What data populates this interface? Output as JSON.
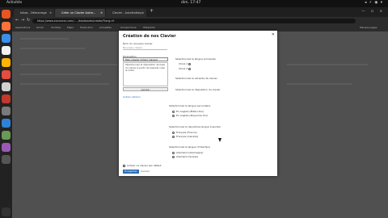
{
  "system": {
    "activities": "Activités",
    "clock": "dim. 17:47",
    "tray": "◂ ⚡ ◉ ▾"
  },
  "browser": {
    "tabs": [
      {
        "label": "Inbox - Démarrage"
      },
      {
        "label": "Créer un Clavier Autre...",
        "active": true
      },
      {
        "label": "Clavier - AutoHotkey..."
      }
    ],
    "url": "https://www.xxxxxxxx.com/...../keyboards/create/?lang=fr",
    "bookmarks": [
      "Applications",
      "Gmail",
      "YouTube",
      "Maps",
      "Traduction",
      "Actualités",
      "Google Drive",
      "Wikipédia",
      "Marque-pages"
    ],
    "controls": "—  ☐  ✕"
  },
  "modal": {
    "title": "Création de nos Clavier",
    "close": "✕",
    "name_label": "Nom du nouveau clavier",
    "name_placeholder": "Nouveau clavier",
    "layout_label": "Disposition",
    "layout_value": "Mon-clavier (Choix clavier)",
    "layout_hint": "Sélectionnez la disposition de base du clavier à partir de laquelle créer le vôtre.",
    "add_button": "Ajouter",
    "more_link": "Autres options",
    "col_right_heading1": "Sélectionnez la langue principale",
    "choices1": [
      "Choix 1",
      "Choix 2"
    ],
    "col_right_heading2": "Sélectionnez la variante de clavier",
    "col_right_heading3": "Sélectionnez la disposition du clavier",
    "sec_a_label": "Sélectionnez la langue secondaire",
    "sec_a_opts": [
      "En anglais (États-Unis)",
      "En anglais (Royaume-Uni)"
    ],
    "sec_b_label": "Sélectionnez la deuxième langue à ajouter",
    "sec_b_opts": [
      "Français (France)",
      "Français (Canada)"
    ],
    "sec_c_label": "Sélectionnez la langue d'interface",
    "sec_c_opts": [
      "Allemand (Allemagne)",
      "Allemand (Suisse)"
    ],
    "checkbox_label": "Activer ce clavier par défaut",
    "save": "Enregistrer",
    "cancel": "Annuler"
  },
  "colors": {
    "accent": "#2f6fb5",
    "page": "#505050",
    "modal": "#ffffff"
  },
  "icons": [
    "ubuntu-dock",
    "firefox-icon",
    "files-icon",
    "terminal-icon",
    "settings-icon",
    "app-icon"
  ]
}
